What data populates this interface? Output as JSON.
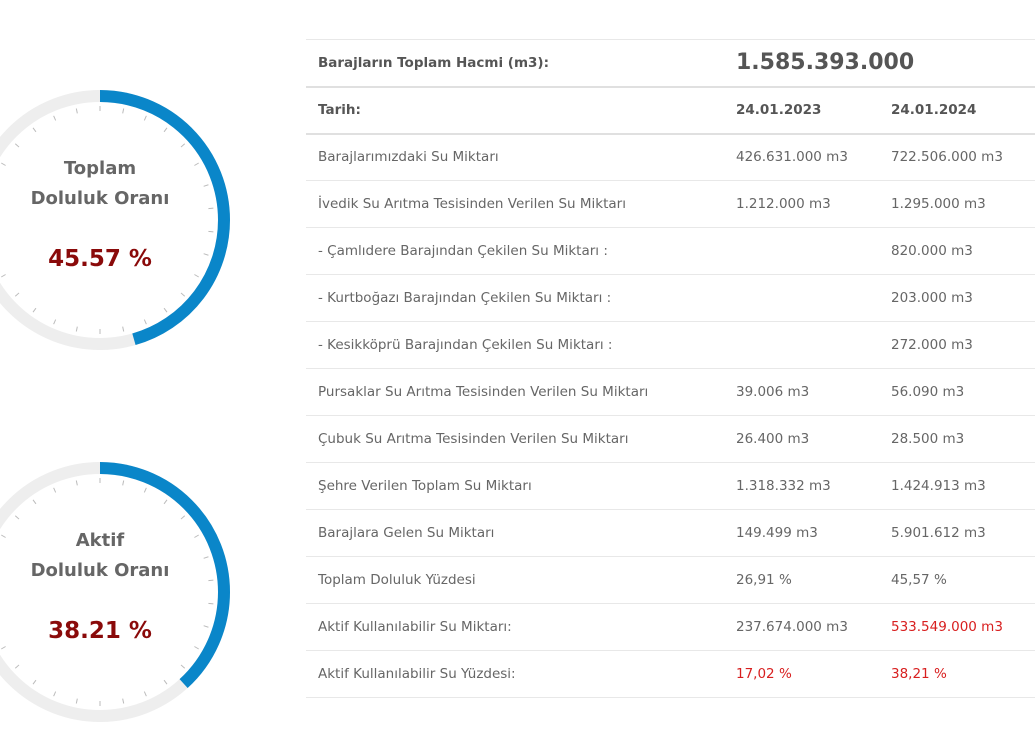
{
  "gauges": [
    {
      "title_line1": "Toplam",
      "title_line2": "Doluluk Oranı",
      "value_text": "45.57 %",
      "fraction": 0.4557,
      "color": "#0a86c9",
      "track": "#eeeeee"
    },
    {
      "title_line1": "Aktif",
      "title_line2": "Doluluk Oranı",
      "value_text": "38.21 %",
      "fraction": 0.3821,
      "color": "#0a86c9",
      "track": "#eeeeee"
    }
  ],
  "table": {
    "volume_label": "Barajların Toplam Hacmi (m3):",
    "volume_value": "1.585.393.000",
    "date_label": "Tarih:",
    "date_1": "24.01.2023",
    "date_2": "24.01.2024",
    "rows": [
      {
        "label": "Barajlarımızdaki Su Miktarı",
        "v1": "426.631.000 m3",
        "v2": "722.506.000 m3"
      },
      {
        "label": "İvedik Su Arıtma Tesisinden Verilen Su Miktarı",
        "v1": "1.212.000 m3",
        "v2": "1.295.000 m3"
      },
      {
        "label": "- Çamlıdere Barajından Çekilen Su Miktarı :",
        "v1": "",
        "v2": "820.000 m3"
      },
      {
        "label": "- Kurtboğazı Barajından Çekilen Su Miktarı :",
        "v1": "",
        "v2": "203.000 m3"
      },
      {
        "label": "- Kesikköprü Barajından Çekilen Su Miktarı :",
        "v1": "",
        "v2": "272.000 m3"
      },
      {
        "label": "Pursaklar Su Arıtma Tesisinden Verilen Su Miktarı",
        "v1": "39.006 m3",
        "v2": "56.090 m3"
      },
      {
        "label": "Çubuk Su Arıtma Tesisinden Verilen Su Miktarı",
        "v1": "26.400 m3",
        "v2": "28.500 m3"
      },
      {
        "label": "Şehre Verilen Toplam Su Miktarı",
        "v1": "1.318.332 m3",
        "v2": "1.424.913 m3"
      },
      {
        "label": "Barajlara Gelen Su Miktarı",
        "v1": "149.499 m3",
        "v2": "5.901.612 m3"
      },
      {
        "label": "Toplam Doluluk Yüzdesi",
        "v1": "26,91 %",
        "v2": "45,57 %"
      },
      {
        "label": "Aktif Kullanılabilir Su Miktarı:",
        "v1": "237.674.000 m3",
        "v2": "533.549.000 m3"
      },
      {
        "label": "Aktif Kullanılabilir Su Yüzdesi:",
        "v1": "17,02 %",
        "v2": "38,21 %"
      }
    ]
  }
}
